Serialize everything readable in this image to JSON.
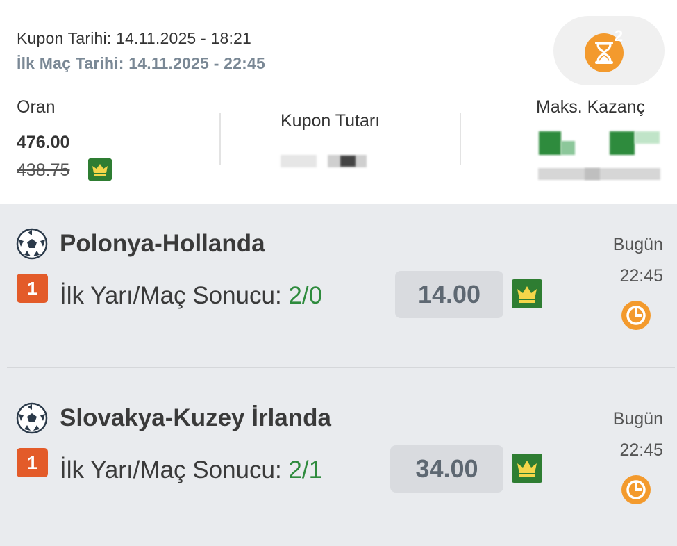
{
  "header": {
    "kupon_tarihi": "Kupon Tarihi: 14.11.2025 - 18:21",
    "ilk_mac_tarihi": "İlk Maç Tarihi: 14.11.2025 - 22:45",
    "timer_badge": "2",
    "timer_icon": "hourglass-icon"
  },
  "stats": {
    "oran_label": "Oran",
    "oran_value": "476.00",
    "oran_old": "438.75",
    "kupon_tutari_label": "Kupon Tutarı",
    "maks_kazanc_label": "Maks. Kazanç"
  },
  "matches": [
    {
      "teams": "Polonya-Hollanda",
      "badge": "1",
      "bet_label": "İlk Yarı/Maç Sonucu: ",
      "bet_result": "2/0",
      "odd": "14.00",
      "day": "Bugün",
      "time": "22:45"
    },
    {
      "teams": "Slovakya-Kuzey İrlanda",
      "badge": "1",
      "bet_label": "İlk Yarı/Maç Sonucu: ",
      "bet_result": "2/1",
      "odd": "34.00",
      "day": "Bugün",
      "time": "22:45"
    }
  ],
  "colors": {
    "accent_orange": "#f39a2d",
    "badge_red": "#e35b29",
    "crown_green": "#2e7d32",
    "result_green": "#2e8b3d"
  }
}
